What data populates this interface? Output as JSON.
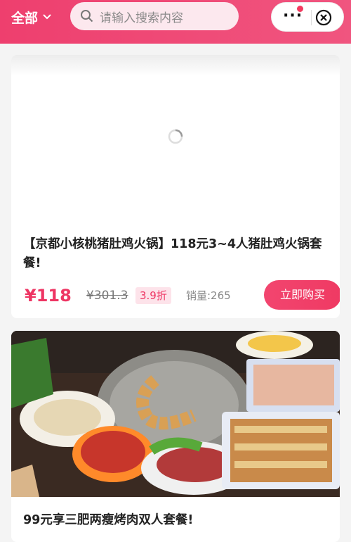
{
  "header": {
    "category": "全部",
    "search_placeholder": "请输入搜索内容",
    "menu_dots": "···"
  },
  "products": [
    {
      "title": "【京都小核桃猪肚鸡火锅】118元3~4人猪肚鸡火锅套餐!",
      "price": "¥118",
      "original_price": "¥301.3",
      "discount": "3.9折",
      "sales": "销量:265",
      "buy_label": "立即购买"
    },
    {
      "title": "99元享三肥两瘦烤肉双人套餐!"
    }
  ],
  "colors": {
    "brand": "#ee3f6e",
    "price": "#ee3563"
  }
}
